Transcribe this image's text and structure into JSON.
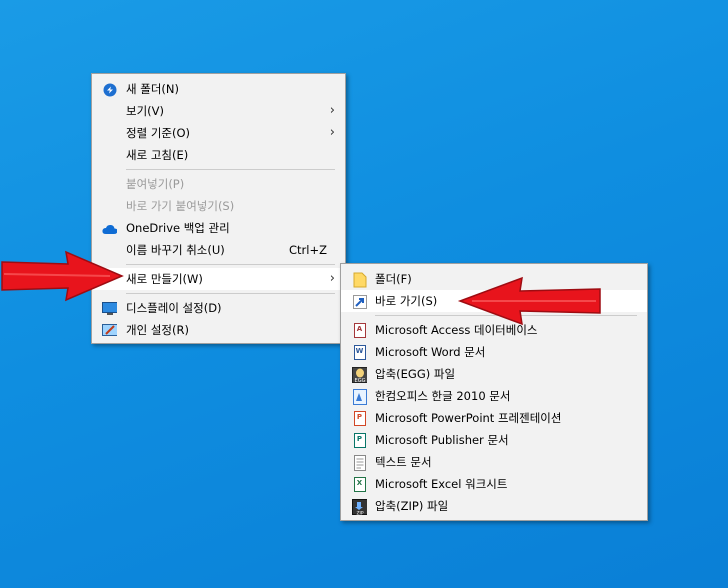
{
  "context_menu": {
    "items": [
      {
        "label": "새 폴더(N)",
        "icon": "new-folder-icon"
      },
      {
        "label": "보기(V)",
        "submenu": true
      },
      {
        "label": "정렬 기준(O)",
        "submenu": true
      },
      {
        "label": "새로 고침(E)"
      },
      {
        "label": "붙여넣기(P)",
        "disabled": true
      },
      {
        "label": "바로 가기 붙여넣기(S)",
        "disabled": true
      },
      {
        "label": "OneDrive 백업 관리",
        "icon": "onedrive-cloud-icon"
      },
      {
        "label": "이름 바꾸기 취소(U)",
        "shortcut": "Ctrl+Z"
      },
      {
        "label": "새로 만들기(W)",
        "submenu": true,
        "highlighted": true
      },
      {
        "label": "디스플레이 설정(D)",
        "icon": "display-icon"
      },
      {
        "label": "개인 설정(R)",
        "icon": "personalize-icon"
      }
    ]
  },
  "new_submenu": {
    "items": [
      {
        "label": "폴더(F)",
        "icon": "folder-icon"
      },
      {
        "label": "바로 가기(S)",
        "icon": "shortcut-icon",
        "highlighted": true
      },
      {
        "label": "Microsoft Access 데이터베이스",
        "icon": "access-icon"
      },
      {
        "label": "Microsoft Word 문서",
        "icon": "word-icon"
      },
      {
        "label": "압축(EGG) 파일",
        "icon": "egg-archive-icon"
      },
      {
        "label": "한컴오피스 한글 2010 문서",
        "icon": "hwp-icon"
      },
      {
        "label": "Microsoft PowerPoint 프레젠테이션",
        "icon": "powerpoint-icon"
      },
      {
        "label": "Microsoft Publisher 문서",
        "icon": "publisher-icon"
      },
      {
        "label": "텍스트 문서",
        "icon": "text-document-icon"
      },
      {
        "label": "Microsoft Excel 워크시트",
        "icon": "excel-icon"
      },
      {
        "label": "압축(ZIP) 파일",
        "icon": "zip-archive-icon"
      }
    ]
  },
  "colors": {
    "desktop": "#0f8ee0",
    "annotation_arrow": "#e8141c"
  }
}
